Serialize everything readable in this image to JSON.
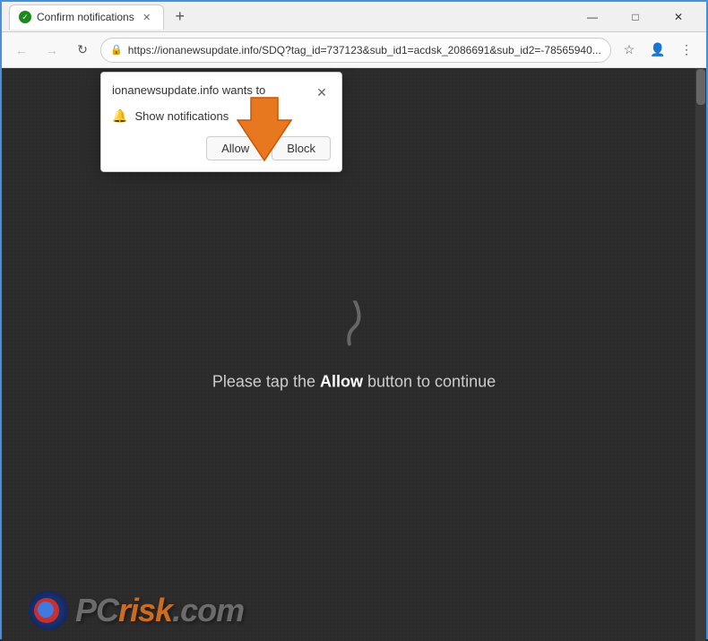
{
  "window": {
    "title": "Confirm notifications",
    "tab_label": "Confirm notifications",
    "new_tab_icon": "+",
    "minimize_icon": "—",
    "maximize_icon": "□",
    "close_icon": "✕"
  },
  "address_bar": {
    "url": "https://ionanewsupdate.info/SDQ?tag_id=737123&sub_id1=acdsk_2086691&sub_id2=-78565940...",
    "lock_icon": "🔒"
  },
  "notification_popup": {
    "title": "ionanewsupdate.info wants to",
    "close_icon": "✕",
    "notification_label": "Show notifications",
    "allow_button": "Allow",
    "block_button": "Block"
  },
  "page": {
    "message_prefix": "Please tap the ",
    "message_bold": "Allow",
    "message_suffix": " button to continue"
  },
  "watermark": {
    "text_pc": "P",
    "text_c": "C",
    "text_risk": "risk",
    "text_com": ".com",
    "full": "PCrisk.com"
  }
}
